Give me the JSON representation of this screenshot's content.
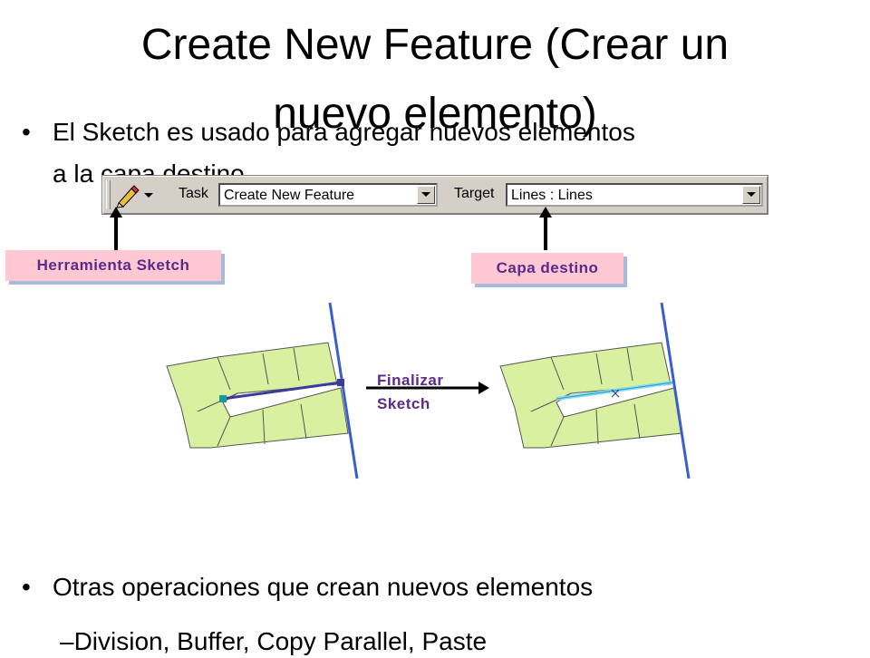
{
  "slide": {
    "title_line1": "Create New Feature (Crear un",
    "title_line2": "nuevo elemento)",
    "bullet1_line1": "El Sketch es usado para agregar nuevos elementos",
    "bullet1_line2": "a la capa destino",
    "bullet2": "Otras operaciones que crean nuevos elementos",
    "sub_bullet": "–Division, Buffer, Copy Parallel, Paste",
    "bullet_glyph": "•"
  },
  "toolbar": {
    "tool_icon": "pencil-icon",
    "task_label": "Task",
    "task_value": "Create New Feature",
    "target_label": "Target",
    "target_value": "Lines : Lines"
  },
  "callouts": {
    "sketch_tool": "Herramienta Sketch",
    "target_layer": "Capa destino"
  },
  "diagram": {
    "arrow_label_line1": "Finalizar",
    "arrow_label_line2": "Sketch"
  },
  "colors": {
    "callout_bg": "#ffc8d2",
    "callout_text": "#5b2a8c",
    "parcel_fill": "#d8f0a0",
    "road_line": "#3a5fcd",
    "sketch_line": "#3b3b9a",
    "new_feature_line": "#7ee0ea"
  }
}
